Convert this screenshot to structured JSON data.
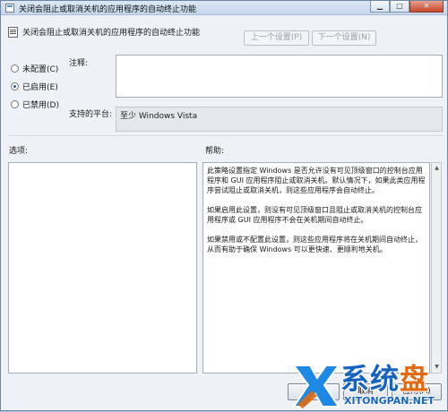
{
  "window": {
    "title": "关闭会阻止或取消关机的应用程序的自动终止功能",
    "controls": {
      "minimize": "▁",
      "maximize": "□",
      "close": "✕"
    }
  },
  "header": {
    "title": "关闭会阻止或取消关机的应用程序的自动终止功能",
    "prev_label": "上一个设置(P)",
    "next_label": "下一个设置(N)"
  },
  "state": {
    "options": [
      {
        "label": "未配置(C)",
        "checked": false
      },
      {
        "label": "已启用(E)",
        "checked": true
      },
      {
        "label": "已禁用(D)",
        "checked": false
      }
    ]
  },
  "fields": {
    "comment_label": "注释:",
    "comment_value": "",
    "platform_label": "支持的平台:",
    "platform_value": "至少 Windows Vista"
  },
  "panels": {
    "options_label": "选项:",
    "help_label": "帮助:",
    "help_paragraphs": [
      "此策略设置指定 Windows 是否允许没有可见顶级窗口的控制台应用程序和 GUI 应用程序阻止或取消关机。默认情况下，如果此类应用程序尝试阻止或取消关机，则这些应用程序会自动终止。",
      "如果启用此设置，则没有可见顶级窗口且阻止或取消关机的控制台应用程序或 GUI 应用程序不会在关机期间自动终止。",
      "如果禁用或不配置此设置，则这些应用程序将在关机期间自动终止，从而有助于确保 Windows 可以更快速、更顺利地关机。"
    ]
  },
  "buttons": {
    "ok": "确定",
    "cancel": "取消",
    "apply": "应用(A)"
  },
  "watermark": {
    "text_main": "系统",
    "text_accent": "盘",
    "url": "XITONGPAN.NET"
  }
}
